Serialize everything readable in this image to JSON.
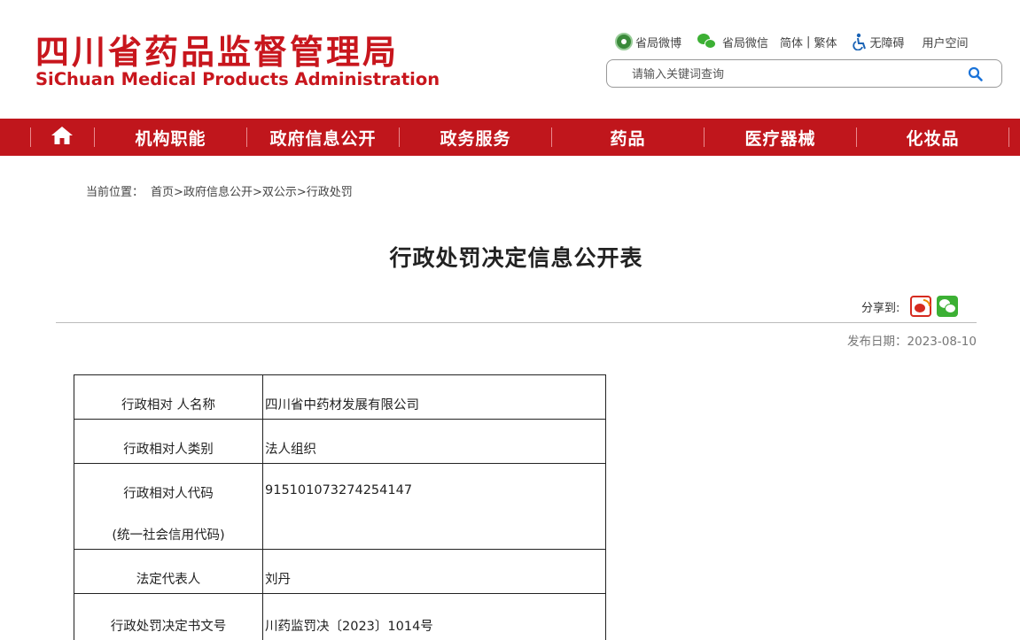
{
  "site": {
    "title_cn": "四川省药品监督管理局",
    "title_en": "SiChuan Medical Products Administration"
  },
  "toplinks": {
    "weibo": "省局微博",
    "wechat": "省局微信",
    "simplified": "简体",
    "divider": "|",
    "traditional": "繁体",
    "accessibility": "无障碍",
    "user_space": "用户空间"
  },
  "search": {
    "placeholder": "请输入关键词查询"
  },
  "nav": {
    "items": [
      {
        "label": "机构职能"
      },
      {
        "label": "政府信息公开"
      },
      {
        "label": "政务服务"
      },
      {
        "label": "药品"
      },
      {
        "label": "医疗器械"
      },
      {
        "label": "化妆品"
      }
    ]
  },
  "breadcrumb": {
    "prefix": "当前位置：",
    "items": [
      "首页",
      "政府信息公开",
      "双公示",
      "行政处罚"
    ],
    "separator": ">"
  },
  "article": {
    "title": "行政处罚决定信息公开表",
    "share_label": "分享到:",
    "publish_label": "发布日期：",
    "publish_date": "2023-08-10"
  },
  "table": {
    "rows": [
      {
        "key": "行政相对 人名称",
        "value": "四川省中药材发展有限公司"
      },
      {
        "key": "行政相对人类别",
        "value": "法人组织"
      },
      {
        "key": "行政相对人代码",
        "key_line2": "(统一社会信用代码)",
        "value": "915101073274254147"
      },
      {
        "key": "法定代表人",
        "value": "刘丹"
      },
      {
        "key": "行政处罚决定书文号",
        "value": "川药监罚决〔2023〕1014号"
      }
    ]
  },
  "colors": {
    "brand_red": "#c8161d",
    "nav_red": "#c0161c"
  }
}
